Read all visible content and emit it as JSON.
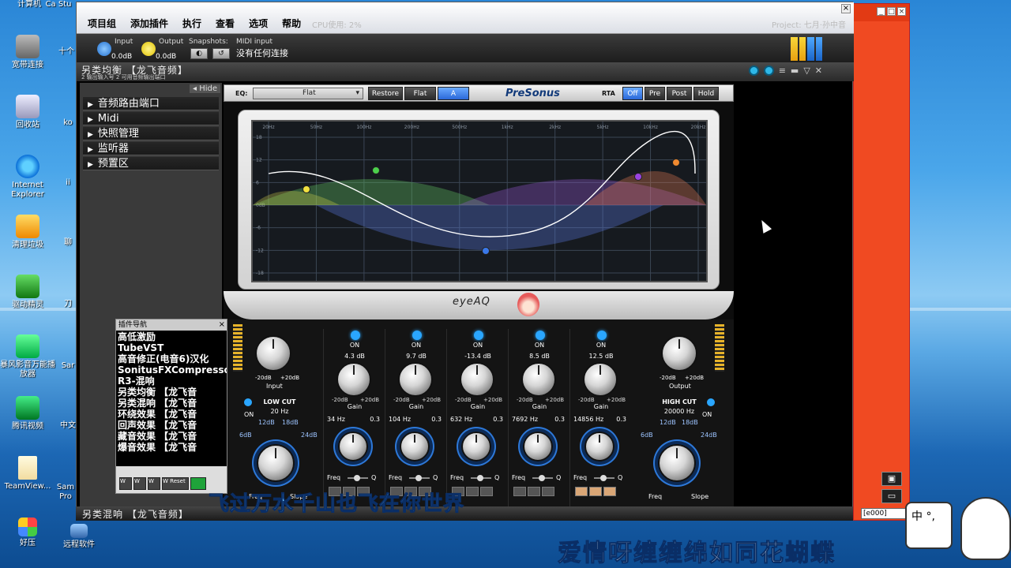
{
  "desktop": {
    "top_labels": [
      "计算机",
      "Ca Stu"
    ],
    "icons": [
      {
        "label": "宽带连接",
        "glyph": "generic"
      },
      {
        "label": "回收站",
        "glyph": "recycle"
      },
      {
        "label": "Internet Explorer",
        "glyph": "ie"
      },
      {
        "label": "清理垃圾",
        "glyph": "app1"
      },
      {
        "label": "驱动精灵",
        "glyph": "app2"
      },
      {
        "label": "暴风影音万能播放器",
        "glyph": "app3"
      },
      {
        "label": "腾讯视频",
        "glyph": "app4"
      },
      {
        "label": "TeamView...",
        "glyph": "file"
      },
      {
        "label": "好压",
        "glyph": "win"
      }
    ],
    "second_column_icons": [
      {
        "label": "十个",
        "glyph": "generic"
      },
      {
        "label": "ko",
        "glyph": "generic"
      },
      {
        "label": "ii",
        "glyph": "generic"
      },
      {
        "label": "聊",
        "glyph": "generic"
      },
      {
        "label": "刀",
        "glyph": "generic"
      },
      {
        "label": "Sar",
        "glyph": "generic"
      },
      {
        "label": "中文",
        "glyph": "generic"
      },
      {
        "label": "Sam Pro",
        "glyph": "generic"
      },
      {
        "label": "远程软件",
        "glyph": "user"
      }
    ]
  },
  "menubar": {
    "items": [
      "项目组",
      "添加插件",
      "执行",
      "查看",
      "选项",
      "帮助"
    ],
    "cpu": "CPU使用: 2%",
    "project": "Project: 七月·孙中音"
  },
  "toolbar": {
    "input_label": "Input",
    "input_value": "0.0dB",
    "output_label": "Output",
    "output_value": "0.0dB",
    "snapshots_label": "Snapshots:",
    "midi_label": "MIDI input",
    "midi_value": "没有任何连接"
  },
  "plugin_title": {
    "title": "另类均衡 【龙飞音频】",
    "subtitle": "2 输出输入号 2 可用音频输出端口"
  },
  "left_panel": {
    "hide": "◂ Hide",
    "items": [
      "音频路由端口",
      "Midi",
      "快照管理",
      "监听器",
      "预置区"
    ]
  },
  "plugin_nav": {
    "header": "插件导航",
    "items": [
      "高低激励",
      "TubeVST",
      "高音修正(电音6)汉化",
      "SonitusFXCompressor压",
      "R3-混响",
      "另类均衡 【龙飞音",
      "另类混响 【龙飞音",
      "环绕效果 【龙飞音",
      "回声效果 【龙飞音",
      "藏音效果 【龙飞音",
      "爆音效果 【龙飞音"
    ],
    "footer_buttons": [
      "W",
      "W",
      "W",
      "W Reset",
      ""
    ]
  },
  "eq": {
    "eq_label": "EQ:",
    "preset": "Flat",
    "buttons": [
      "Restore",
      "Flat",
      "A"
    ],
    "brand": "PreSonus",
    "rta_label": "RTA",
    "rta_buttons": [
      "Off",
      "Pre",
      "Post",
      "Hold"
    ],
    "logo": "eyeAQ",
    "graph_freq_labels": [
      "20Hz",
      "50Hz",
      "100Hz",
      "200Hz",
      "500Hz",
      "1kHz",
      "2kHz",
      "5kHz",
      "10kHz",
      "20kHz"
    ],
    "graph_db_labels": [
      "18",
      "12",
      "6",
      "0dB",
      "-6",
      "-12",
      "-18"
    ],
    "input": {
      "range_low": "-20dB",
      "range_high": "+20dB",
      "label": "Input"
    },
    "output": {
      "range_low": "-20dB",
      "range_high": "+20dB",
      "label": "Output"
    },
    "low_cut": {
      "title": "LOW CUT",
      "on": "ON",
      "freq": "20 Hz",
      "slopes": [
        "6dB",
        "12dB",
        "18dB",
        "24dB"
      ],
      "freq_label": "Freq",
      "slope_label": "Slope"
    },
    "high_cut": {
      "title": "HIGH CUT",
      "on": "ON",
      "freq": "20000 Hz",
      "slopes": [
        "6dB",
        "12dB",
        "18dB",
        "24dB"
      ],
      "freq_label": "Freq",
      "slope_label": "Slope"
    },
    "bands": [
      {
        "on": "ON",
        "db": "4.3 dB",
        "gain_low": "-20dB",
        "gain_high": "+20dB",
        "gain_label": "Gain",
        "freq": "34 Hz",
        "q": "0.3",
        "freq_label": "Freq",
        "q_label": "Q"
      },
      {
        "on": "ON",
        "db": "9.7 dB",
        "gain_low": "-20dB",
        "gain_high": "+20dB",
        "gain_label": "Gain",
        "freq": "104 Hz",
        "q": "0.3",
        "freq_label": "Freq",
        "q_label": "Q"
      },
      {
        "on": "ON",
        "db": "-13.4 dB",
        "gain_low": "-20dB",
        "gain_high": "+20dB",
        "gain_label": "Gain",
        "freq": "632 Hz",
        "q": "0.3",
        "freq_label": "Freq",
        "q_label": "Q"
      },
      {
        "on": "ON",
        "db": "8.5 dB",
        "gain_low": "-20dB",
        "gain_high": "+20dB",
        "gain_label": "Gain",
        "freq": "7692 Hz",
        "q": "0.3",
        "freq_label": "Freq",
        "q_label": "Q"
      },
      {
        "on": "ON",
        "db": "12.5 dB",
        "gain_low": "-20dB",
        "gain_high": "+20dB",
        "gain_label": "Gain",
        "freq": "14856 Hz",
        "q": "0.3",
        "freq_label": "Freq",
        "q_label": "Q"
      }
    ]
  },
  "bottom_bar": {
    "title": "另类混响 【龙飞音频】"
  },
  "code_box": "[e000]",
  "lyrics": {
    "line1": "飞过万水千山也飞在你世界",
    "line2": "爱情呀缠缠绵如同花蝴蝶"
  },
  "mascot": {
    "text": "中 °,"
  },
  "colors": {
    "accent_blue": "#2a78d8",
    "led_blue": "#2aa6ff",
    "red_window": "#f04a22",
    "meter_yellow": "#e7b32a"
  }
}
